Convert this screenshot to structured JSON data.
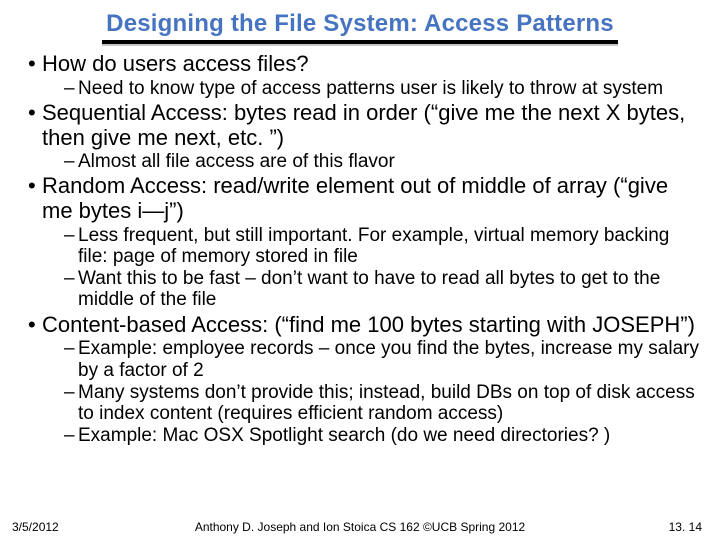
{
  "title": "Designing the File System: Access Patterns",
  "bullets": {
    "q1": "How do users access files?",
    "q1a": "Need to know type of access patterns user is likely to throw at system",
    "seq": "Sequential Access: bytes read in order (“give me the next X bytes, then give me next, etc. ”)",
    "seq_a": "Almost all file access are of this flavor",
    "rand": "Random Access: read/write element out of middle of array (“give me bytes i—j”)",
    "rand_a": "Less frequent, but still important. For example, virtual memory backing file: page of memory stored in file",
    "rand_b": "Want this to be fast – don’t want to have to read all bytes to get to the middle of the file",
    "cont": "Content-based Access: (“find me 100 bytes starting with JOSEPH”)",
    "cont_a": "Example: employee records – once you find the bytes, increase my salary by a factor of 2",
    "cont_b": "Many systems don’t provide this; instead, build DBs on top of disk access to index content (requires efficient random access)",
    "cont_c": "Example: Mac OSX Spotlight search (do we need directories? )"
  },
  "footer": {
    "date": "3/5/2012",
    "center": "Anthony D. Joseph and Ion Stoica CS 162 ©UCB Spring 2012",
    "page": "13. 14"
  }
}
